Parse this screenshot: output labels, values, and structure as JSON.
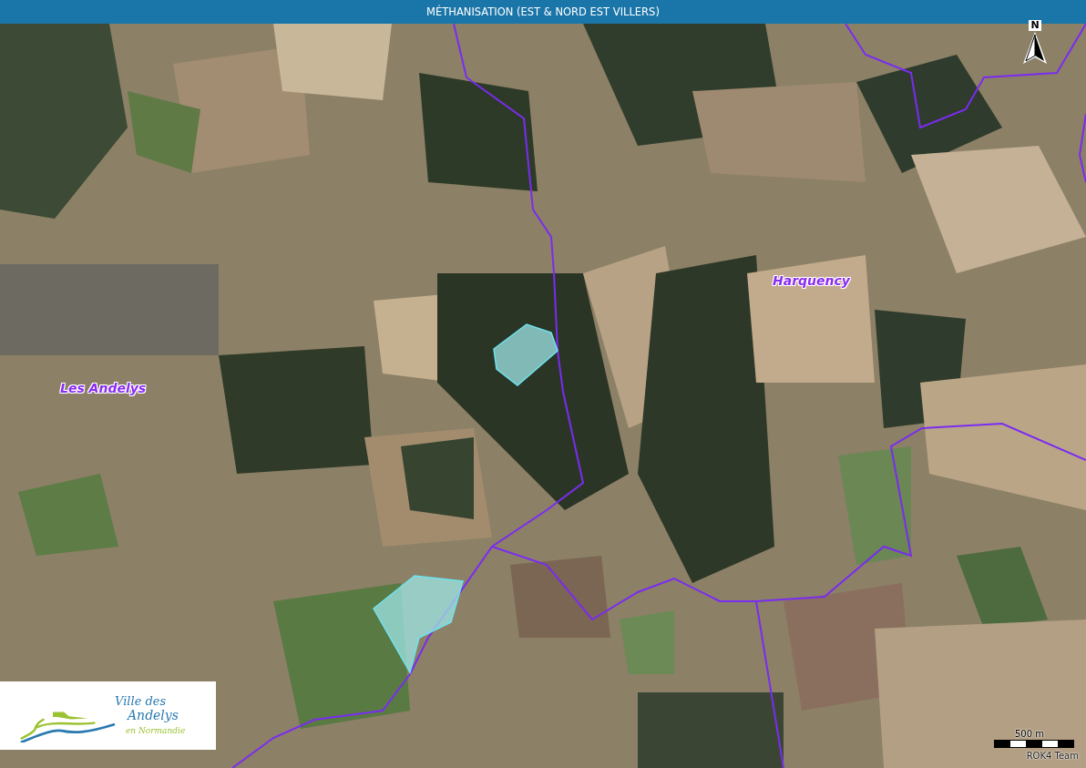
{
  "header": {
    "title": "MÉTHANISATION (EST & NORD EST VILLERS)"
  },
  "map": {
    "place_labels": [
      {
        "text": "Harquency"
      },
      {
        "text": "Les Andelys"
      }
    ],
    "north_arrow": {
      "label": "N"
    },
    "scale_bar": {
      "label": "500 m"
    },
    "attribution": "ROK4 Team"
  },
  "logo": {
    "line_1": "Ville des",
    "line_2": "Andelys",
    "line_3": "en Normandie"
  }
}
